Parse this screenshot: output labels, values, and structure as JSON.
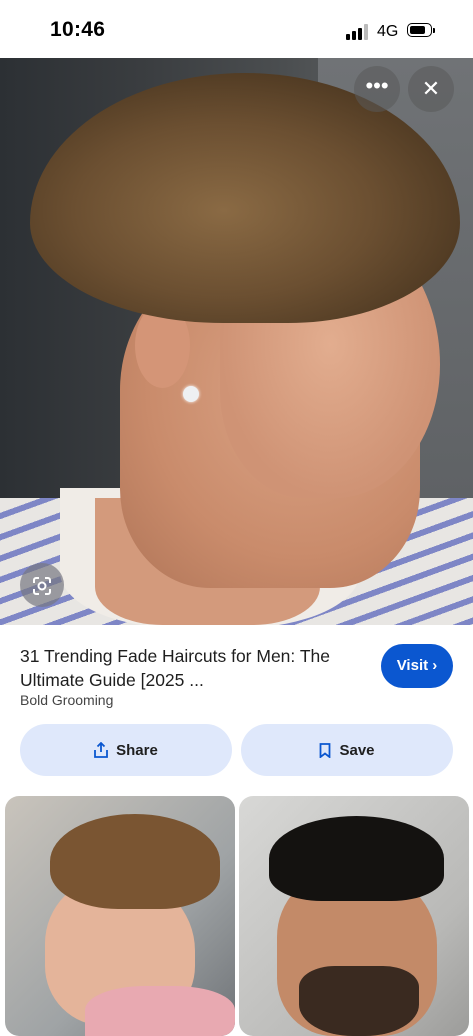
{
  "status_bar": {
    "time": "10:46",
    "network": "4G"
  },
  "hero": {
    "more_icon": "more-horizontal-icon",
    "close_icon": "close-icon",
    "lens_icon": "lens-icon"
  },
  "result": {
    "title": "31 Trending Fade Haircuts for Men: The Ultimate Guide [2025 ...",
    "source": "Bold Grooming",
    "visit_label": "Visit",
    "share_label": "Share",
    "save_label": "Save"
  },
  "colors": {
    "accent": "#0b57d0",
    "pill_bg": "#dfe8fb"
  }
}
